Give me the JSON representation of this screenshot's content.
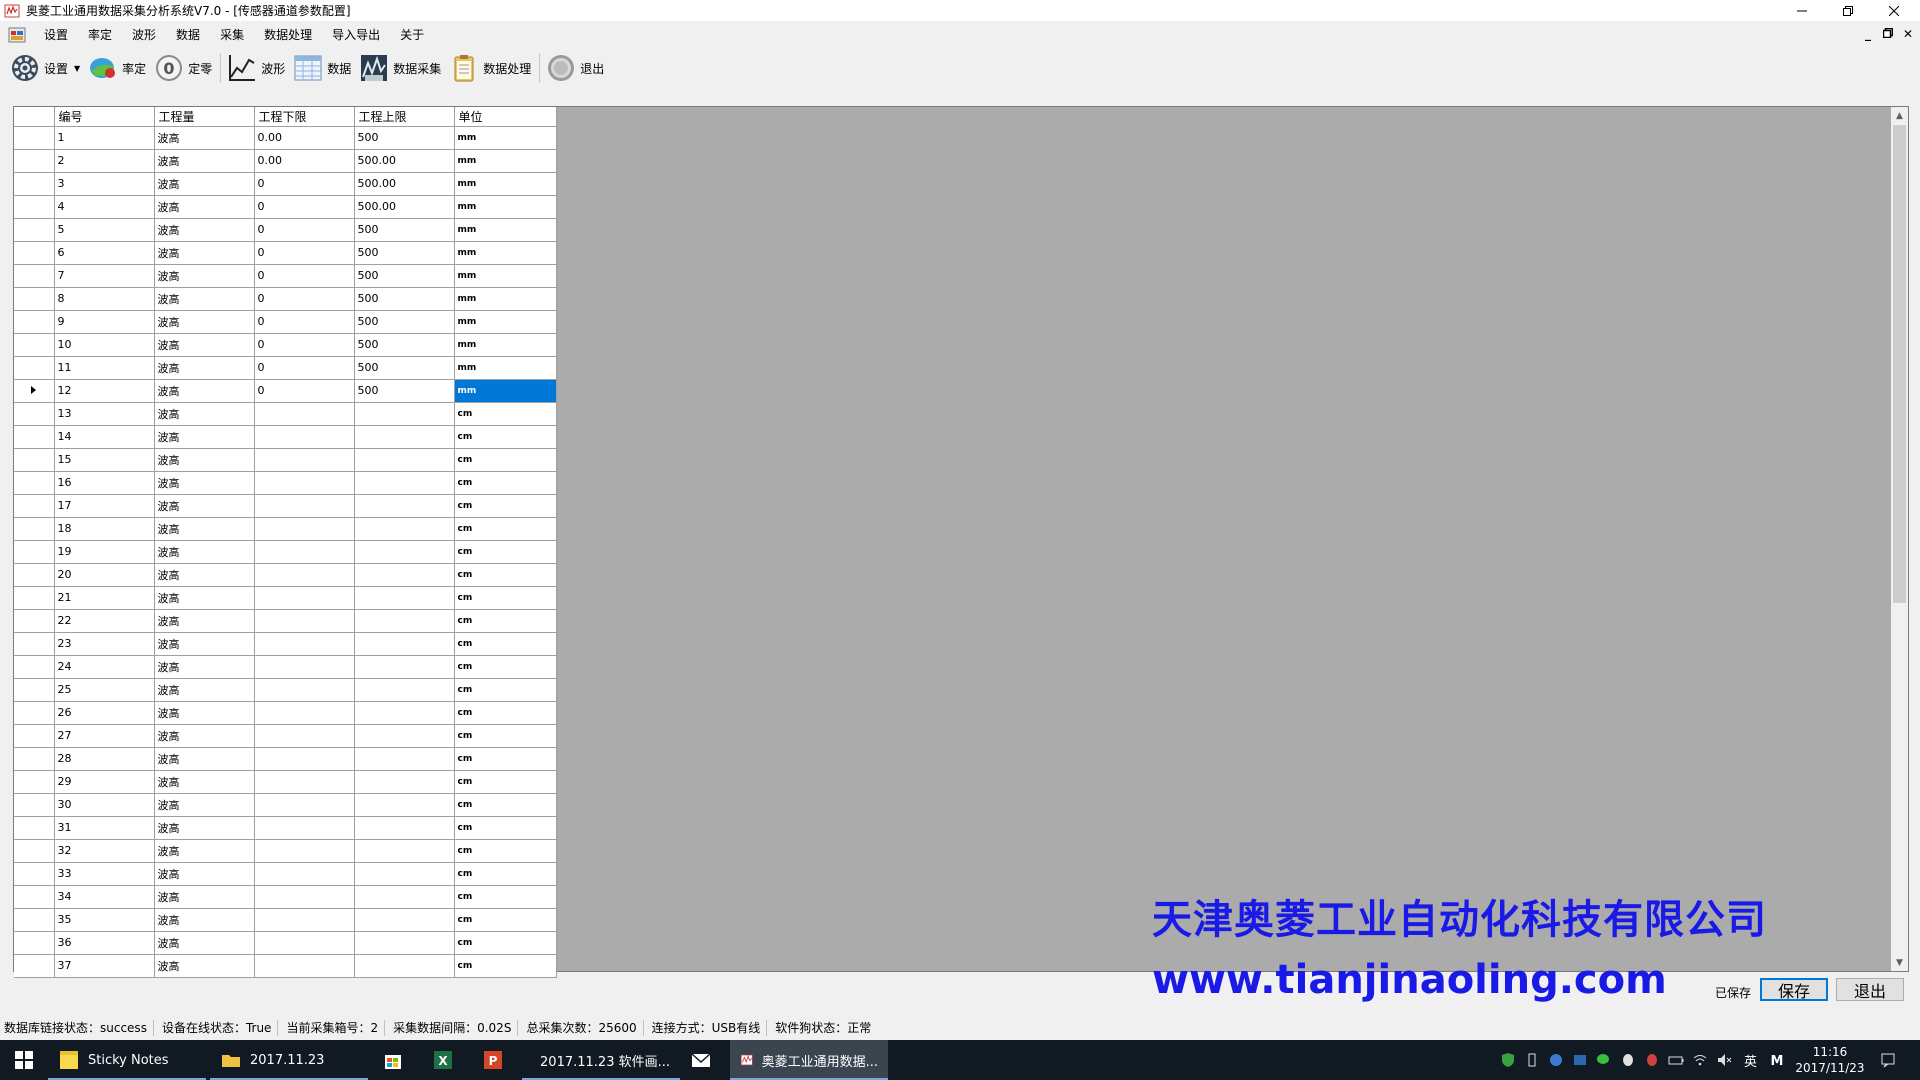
{
  "window": {
    "title": "奥菱工业通用数据采集分析系统V7.0 - [传感器通道参数配置]"
  },
  "menu": {
    "items": [
      "设置",
      "率定",
      "波形",
      "数据",
      "采集",
      "数据处理",
      "导入导出",
      "关于"
    ]
  },
  "toolbar": {
    "settings": "设置",
    "calibrate": "率定",
    "zero": "定零",
    "waveform": "波形",
    "data": "数据",
    "acquire": "数据采集",
    "process": "数据处理",
    "exit": "退出"
  },
  "grid": {
    "columns": [
      "编号",
      "工程量",
      "工程下限",
      "工程上限",
      "单位"
    ],
    "selected_row": 12,
    "rows": [
      [
        "1",
        "波高",
        "0.00",
        "500",
        "mm"
      ],
      [
        "2",
        "波高",
        "0.00",
        "500.00",
        "mm"
      ],
      [
        "3",
        "波高",
        "0",
        "500.00",
        "mm"
      ],
      [
        "4",
        "波高",
        "0",
        "500.00",
        "mm"
      ],
      [
        "5",
        "波高",
        "0",
        "500",
        "mm"
      ],
      [
        "6",
        "波高",
        "0",
        "500",
        "mm"
      ],
      [
        "7",
        "波高",
        "0",
        "500",
        "mm"
      ],
      [
        "8",
        "波高",
        "0",
        "500",
        "mm"
      ],
      [
        "9",
        "波高",
        "0",
        "500",
        "mm"
      ],
      [
        "10",
        "波高",
        "0",
        "500",
        "mm"
      ],
      [
        "11",
        "波高",
        "0",
        "500",
        "mm"
      ],
      [
        "12",
        "波高",
        "0",
        "500",
        "mm"
      ],
      [
        "13",
        "波高",
        "",
        "",
        "cm"
      ],
      [
        "14",
        "波高",
        "",
        "",
        "cm"
      ],
      [
        "15",
        "波高",
        "",
        "",
        "cm"
      ],
      [
        "16",
        "波高",
        "",
        "",
        "cm"
      ],
      [
        "17",
        "波高",
        "",
        "",
        "cm"
      ],
      [
        "18",
        "波高",
        "",
        "",
        "cm"
      ],
      [
        "19",
        "波高",
        "",
        "",
        "cm"
      ],
      [
        "20",
        "波高",
        "",
        "",
        "cm"
      ],
      [
        "21",
        "波高",
        "",
        "",
        "cm"
      ],
      [
        "22",
        "波高",
        "",
        "",
        "cm"
      ],
      [
        "23",
        "波高",
        "",
        "",
        "cm"
      ],
      [
        "24",
        "波高",
        "",
        "",
        "cm"
      ],
      [
        "25",
        "波高",
        "",
        "",
        "cm"
      ],
      [
        "26",
        "波高",
        "",
        "",
        "cm"
      ],
      [
        "27",
        "波高",
        "",
        "",
        "cm"
      ],
      [
        "28",
        "波高",
        "",
        "",
        "cm"
      ],
      [
        "29",
        "波高",
        "",
        "",
        "cm"
      ],
      [
        "30",
        "波高",
        "",
        "",
        "cm"
      ],
      [
        "31",
        "波高",
        "",
        "",
        "cm"
      ],
      [
        "32",
        "波高",
        "",
        "",
        "cm"
      ],
      [
        "33",
        "波高",
        "",
        "",
        "cm"
      ],
      [
        "34",
        "波高",
        "",
        "",
        "cm"
      ],
      [
        "35",
        "波高",
        "",
        "",
        "cm"
      ],
      [
        "36",
        "波高",
        "",
        "",
        "cm"
      ],
      [
        "37",
        "波高",
        "",
        "",
        "cm"
      ]
    ]
  },
  "watermark": {
    "company": "天津奥菱工业自动化科技有限公司",
    "url": "www.tianjinaoling.com"
  },
  "footer": {
    "saved": "已保存",
    "save": "保存",
    "exit": "退出"
  },
  "status": {
    "db": "数据库链接状态：success",
    "device": "设备在线状态：True",
    "box": "当前采集箱号：2",
    "interval": "采集数据间隔：0.02S",
    "total": "总采集次数：25600",
    "conn": "连接方式：USB有线",
    "dongle": "软件狗状态：正常"
  },
  "taskbar": {
    "items": [
      {
        "label": "Sticky Notes",
        "icon": "sticky-notes-icon"
      },
      {
        "label": "2017.11.23",
        "icon": "folder-icon"
      },
      {
        "label": "",
        "icon": "store-icon"
      },
      {
        "label": "",
        "icon": "excel-icon"
      },
      {
        "label": "",
        "icon": "powerpoint-icon"
      },
      {
        "label": "2017.11.23 软件画...",
        "icon": "word-icon"
      },
      {
        "label": "",
        "icon": "mail-icon"
      },
      {
        "label": "奥菱工业通用数据...",
        "icon": "app-icon"
      }
    ],
    "ime": "英",
    "time": "11:16",
    "date": "2017/11/23"
  },
  "colors": {
    "selection": "#0078d7",
    "watermark": "#1a1ae6",
    "grid_background": "#ababab",
    "taskbar": "#111a22"
  }
}
